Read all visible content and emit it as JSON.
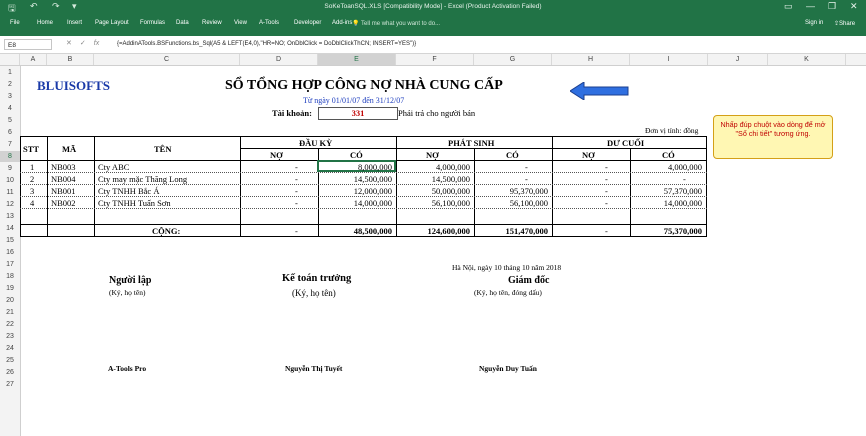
{
  "titlebar": {
    "title": "SoKeToanSQL.XLS  [Compatibility Mode]  -  Excel (Product Activation Failed)",
    "minimize": "—",
    "restore": "❐",
    "close": "✕"
  },
  "ribbon": {
    "tabs": [
      "File",
      "Home",
      "Insert",
      "Page Layout",
      "Formulas",
      "Data",
      "Review",
      "View",
      "A-Tools",
      "Developer",
      "Add-ins"
    ],
    "tell_me": "Tell me what you want to do...",
    "sign_in": "Sign in",
    "share": "Share"
  },
  "formula_bar": {
    "name_box": "E8",
    "formula": "{=AddinATools.BSFunctions.bs_Sql(A5 & LEFT(E4,0),\"HR=NO; OnDblClick = DoDblClickThCN; INSERT=YES\")}"
  },
  "columns": [
    "A",
    "B",
    "C",
    "D",
    "E",
    "F",
    "G",
    "H",
    "I",
    "J",
    "K"
  ],
  "rows": [
    "1",
    "2",
    "3",
    "4",
    "5",
    "6",
    "7",
    "8",
    "9",
    "10",
    "11",
    "12",
    "13",
    "14",
    "15",
    "16",
    "17",
    "18",
    "19",
    "20",
    "21",
    "22",
    "23",
    "24",
    "25",
    "26",
    "27"
  ],
  "sheet": {
    "logo_text": "BLUISOFTS",
    "title": "SỔ TỔNG HỢP CÔNG NỢ NHÀ CUNG CẤP",
    "period": "Từ ngày 01/01/07 đến 31/12/07",
    "account_label": "Tài khoản:",
    "account_value": "331",
    "account_desc": "Phải trả cho người bán",
    "unit": "Đơn vị tính: đồng",
    "headers": {
      "stt": "STT",
      "ma": "MÃ",
      "ten": "TÊN",
      "dau_ky": "ĐẦU KỲ",
      "phat_sinh": "PHÁT SINH",
      "du_cuoi": "DƯ CUỐI",
      "no": "NỢ",
      "co": "CÓ"
    },
    "data_rows": [
      {
        "stt": "1",
        "ma": "NB003",
        "ten": "Cty ABC",
        "dk_no": "-",
        "dk_co": "8,000,000",
        "ps_no": "4,000,000",
        "ps_co": "-",
        "dc_no": "-",
        "dc_co": "4,000,000"
      },
      {
        "stt": "2",
        "ma": "NB004",
        "ten": "Cty may mặc Thăng Long",
        "dk_no": "-",
        "dk_co": "14,500,000",
        "ps_no": "14,500,000",
        "ps_co": "-",
        "dc_no": "-",
        "dc_co": "-"
      },
      {
        "stt": "3",
        "ma": "NB001",
        "ten": "Cty TNHH Bắc Á",
        "dk_no": "-",
        "dk_co": "12,000,000",
        "ps_no": "50,000,000",
        "ps_co": "95,370,000",
        "dc_no": "-",
        "dc_co": "57,370,000"
      },
      {
        "stt": "4",
        "ma": "NB002",
        "ten": "Cty TNHH Tuấn Sơn",
        "dk_no": "-",
        "dk_co": "14,000,000",
        "ps_no": "56,100,000",
        "ps_co": "56,100,000",
        "dc_no": "-",
        "dc_co": "14,000,000"
      }
    ],
    "total": {
      "label": "CỘNG:",
      "dk_no": "-",
      "dk_co": "48,500,000",
      "ps_no": "124,600,000",
      "ps_co": "151,470,000",
      "dc_no": "-",
      "dc_co": "75,370,000"
    },
    "date_line": "Hà Nội, ngày 10 tháng 10 năm 2018",
    "signers": [
      {
        "title": "Người lập",
        "sub": "(Ký, họ tên)",
        "name": "A-Tools Pro"
      },
      {
        "title": "Kế toán trưởng",
        "sub": "(Ký, họ tên)",
        "name": "Nguyễn Thị Tuyết"
      },
      {
        "title": "Giám đốc",
        "sub": "(Ký, họ tên, đóng dấu)",
        "name": "Nguyễn Duy Tuấn"
      }
    ],
    "note": "Nhấp đúp chuột vào dòng để mở \"Sổ chi tiết\" tương ứng."
  },
  "colors": {
    "ribbon": "#217346",
    "arrow": "#2f6fe0",
    "note_text": "#c00000",
    "note_bg": "#fff7b3",
    "account": "#c00000",
    "period": "#1f3fbf"
  }
}
